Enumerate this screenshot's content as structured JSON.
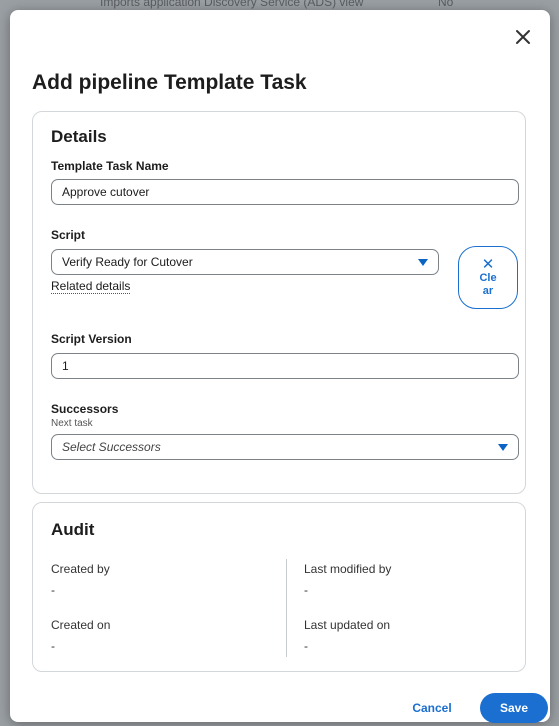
{
  "background": {
    "row_text": "Imports application Discovery Service (ADS) view",
    "row_value": "No"
  },
  "modal": {
    "title": "Add pipeline Template Task",
    "close_icon": "close-icon"
  },
  "details": {
    "heading": "Details",
    "task_name_label": "Template Task Name",
    "task_name_value": "Approve cutover",
    "script_label": "Script",
    "script_value": "Verify Ready for Cutover",
    "related_details_link": "Related details",
    "clear_button": {
      "icon": "x",
      "line1": "Cle",
      "line2": "ar"
    },
    "script_version_label": "Script Version",
    "script_version_value": "1",
    "successors_label": "Successors",
    "successors_sublabel": "Next task",
    "successors_placeholder": "Select Successors"
  },
  "audit": {
    "heading": "Audit",
    "created_by_label": "Created by",
    "created_by_value": "-",
    "created_on_label": "Created on",
    "created_on_value": "-",
    "last_modified_by_label": "Last modified by",
    "last_modified_by_value": "-",
    "last_updated_on_label": "Last updated on",
    "last_updated_on_value": "-"
  },
  "footer": {
    "cancel_label": "Cancel",
    "save_label": "Save"
  },
  "colors": {
    "accent": "#1a6fd0",
    "overlay": "#9a9fa3"
  }
}
